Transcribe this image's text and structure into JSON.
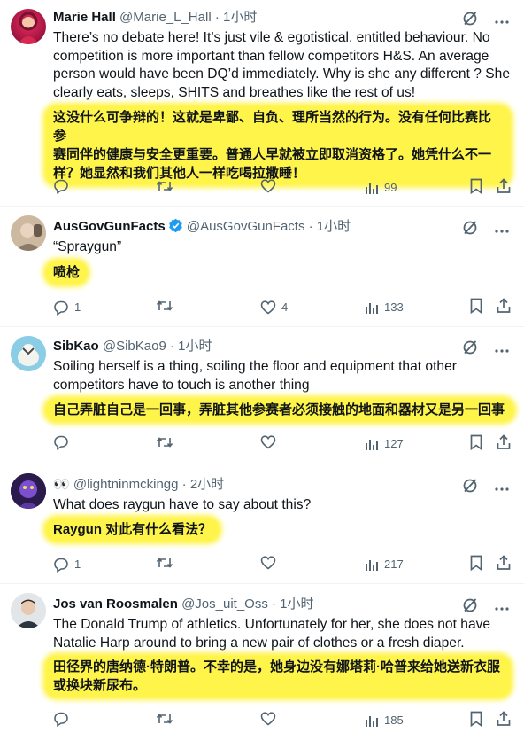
{
  "tweets": [
    {
      "name": "Marie Hall",
      "handle": "@Marie_L_Hall",
      "time": "· 1小时",
      "verified": false,
      "text": "There’s no debate here! It’s just vile & egotistical, entitled behaviour. No competition is more important than fellow competitors H&S. An average person would have been DQ’d immediately. Why is she any different ? She clearly eats, sleeps, SHITS and breathes like the rest of us!",
      "translation_lines": [
        "这没什么可争辩的！这就是卑鄙、自负、理所当然的行为。没有任何比赛比参",
        "赛同伴的健康与安全更重要。普通人早就被立即取消资格了。她凭什么不一",
        "样？她显然和我们其他人一样吃喝拉撒睡！"
      ],
      "replies": "",
      "likes": "",
      "views": "99"
    },
    {
      "name": "AusGovGunFacts",
      "handle": "@AusGovGunFacts",
      "time": "· 1小时",
      "verified": true,
      "text": "“Spraygun”",
      "translation_lines": [
        "喷枪"
      ],
      "replies": "1",
      "likes": "4",
      "views": "133"
    },
    {
      "name": "SibKao",
      "handle": "@SibKao9",
      "time": "· 1小时",
      "verified": false,
      "text": "Soiling herself is a thing, soiling the floor and equipment that other competitors have to touch is another thing",
      "translation_lines": [
        "自己弄脏自己是一回事，弄脏其他参赛者必须接触的地面和器材又是另一回事"
      ],
      "replies": "",
      "likes": "",
      "views": "127"
    },
    {
      "name": "👀",
      "handle": "@lightninmckingg",
      "time": "· 2小时",
      "verified": false,
      "text": "What does raygun have to say about this?",
      "translation_lines": [
        "Raygun 对此有什么看法？"
      ],
      "replies": "1",
      "likes": "",
      "views": "217"
    },
    {
      "name": "Jos van Roosmalen",
      "handle": "@Jos_uit_Oss",
      "time": "· 1小时",
      "verified": false,
      "text": "The Donald Trump of athletics. Unfortunately for her, she does not have Natalie Harp around to bring a new pair of clothes or a fresh diaper.",
      "translation_lines": [
        "田径界的唐纳德·特朗普。不幸的是，她身边没有娜塔莉·哈普来给她送新衣服",
        "或换块新尿布。"
      ],
      "replies": "",
      "likes": "",
      "views": "185"
    }
  ],
  "colors": {
    "text": "#0f1419",
    "muted": "#536471",
    "highlight": "#fff44a",
    "verified": "#1d9bf0",
    "divider": "#eff3f4"
  },
  "icons": [
    "grok-icon",
    "more-icon",
    "reply-icon",
    "retweet-icon",
    "like-icon",
    "views-icon",
    "bookmark-icon",
    "share-icon",
    "verified-badge-icon"
  ]
}
